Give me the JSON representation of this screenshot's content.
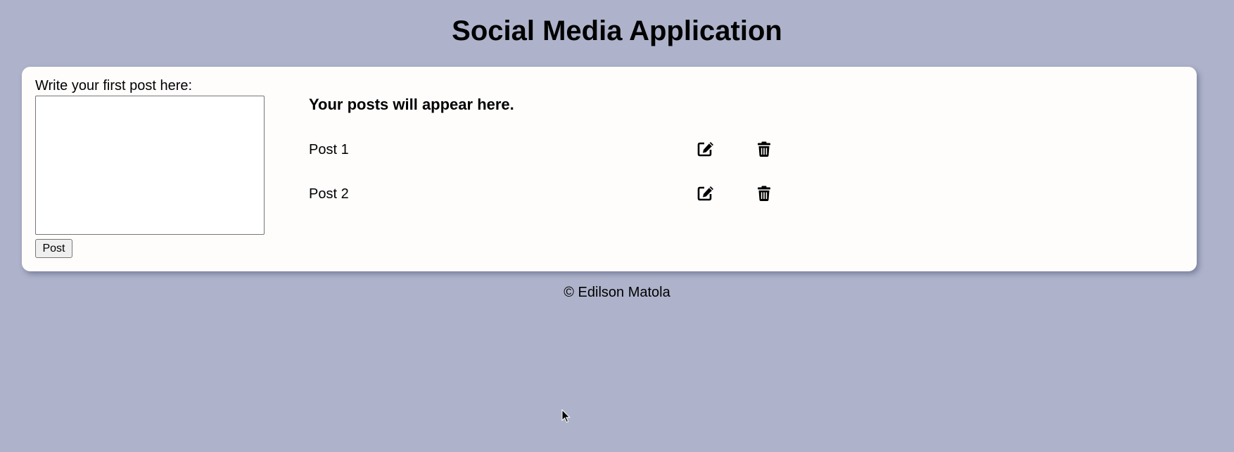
{
  "app": {
    "title": "Social Media Application"
  },
  "composer": {
    "label": "Write your first post here:",
    "value": "",
    "placeholder": "",
    "post_button_label": "Post"
  },
  "feed": {
    "heading": "Your posts will appear here.",
    "posts": [
      {
        "text": "Post 1",
        "edit_icon": "edit-icon",
        "delete_icon": "trash-icon"
      },
      {
        "text": "Post 2",
        "edit_icon": "edit-icon",
        "delete_icon": "trash-icon"
      }
    ]
  },
  "footer": {
    "text": "© Edilson Matola"
  },
  "colors": {
    "page_background": "#aeb3cb",
    "card_background": "#fffdfc",
    "text": "#000000"
  }
}
